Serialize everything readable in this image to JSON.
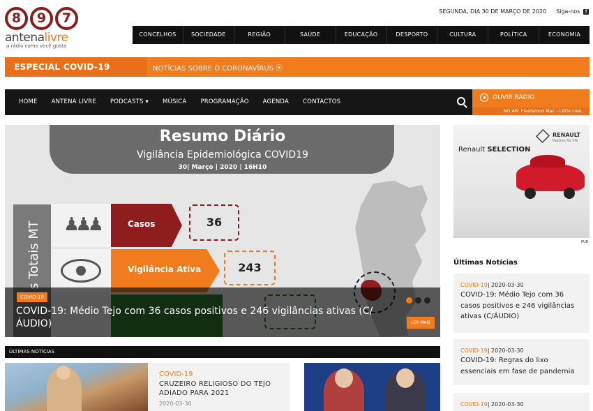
{
  "logo": {
    "digits": [
      "8",
      "9",
      "7"
    ],
    "word_a": "antena",
    "word_b": "livre",
    "tagline": "a rádio como você gosta"
  },
  "header": {
    "date": "SEGUNDA, DIA 30 DE MARÇO DE 2020",
    "follow": "Siga-nos",
    "follow_icon": "facebook-icon"
  },
  "categories": [
    "CONCELHOS",
    "SOCIEDADE",
    "REGIÃO",
    "SAÚDE",
    "EDUCAÇÃO",
    "DESPORTO",
    "CULTURA",
    "POLÍTICA",
    "ECONOMIA"
  ],
  "covid_banner": {
    "title": "ESPECIAL COVID-19",
    "link": "NOTÍCIAS SOBRE O CORONAVÍRUS ⦿"
  },
  "nav": {
    "items": [
      "HOME",
      "ANTENA LIVRE",
      "PODCASTS ▾",
      "MÚSICA",
      "PROGRAMAÇÃO",
      "AGENDA",
      "CONTACTOS"
    ],
    "radio_label": "OUVIR RÁDIO",
    "now_playing": "NO AR: Fleetwood Mac - Little Lies"
  },
  "hero": {
    "image_title": "Resumo Diário",
    "image_subtitle": "Vigilância Epidemiológica COVID19",
    "image_date": "30| Março | 2020 | 16H10",
    "totals_label": "s Totais MT",
    "casos_label": "Casos",
    "casos_value": "36",
    "vig_label": "Vigilância Ativa",
    "vig_value": "243",
    "tag": "COVID-19",
    "headline": "COVID-19: Médio Tejo com 36 casos positivos e 246 vigilâncias ativas (C/ÁUDIO)",
    "read_more": "LER MAIS"
  },
  "latest_bar": "ÚLTIMAS NOTÍCIAS",
  "cards": [
    {
      "category": "COVID-19",
      "title": "CRUZEIRO RELIGIOSO DO TEJO ADIADO PARA 2021",
      "date": "2020-03-30"
    }
  ],
  "ad": {
    "brand": "RENAULT",
    "brand_small": "Passion for life",
    "selection_a": "Renault ",
    "selection_b": "SELECTION",
    "pub": "PUB"
  },
  "sidebar": {
    "title": "Últimas Notícias",
    "items": [
      {
        "category": "COVID-19",
        "date": "| 2020-03-30",
        "title": "COVID-19: Médio Tejo com 36 casos positivos e 246 vigilâncias ativas (C/ÁUDIO)"
      },
      {
        "category": "COVID-19",
        "date": "| 2020-03-30",
        "title": "COVID-19: Regras do lixo essenciais em fase de pandemia"
      },
      {
        "category": "COVID-19",
        "date": "| 2020-03-30",
        "title": ""
      }
    ]
  },
  "colors": {
    "accent": "#f07c1e",
    "dark": "#161616",
    "brand_red": "#8a1c1c"
  }
}
